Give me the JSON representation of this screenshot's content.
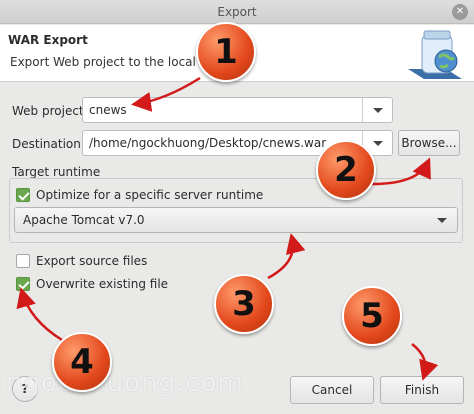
{
  "window": {
    "title": "Export",
    "close_glyph": "✕"
  },
  "header": {
    "title": "WAR Export",
    "subtitle": "Export Web project to the local file s"
  },
  "form": {
    "web_project_label": "Web project:",
    "web_project_value": "cnews",
    "destination_label": "Destination:",
    "destination_value": "/home/ngockhuong/Desktop/cnews.war",
    "browse_label": "Browse..."
  },
  "target_runtime": {
    "group_label": "Target runtime",
    "optimize_label": "Optimize for a specific server runtime",
    "optimize_checked": true,
    "runtime_value": "Apache Tomcat v7.0"
  },
  "options": {
    "export_source_label": "Export source files",
    "export_source_checked": false,
    "overwrite_label": "Overwrite existing file",
    "overwrite_checked": true
  },
  "footer": {
    "help_glyph": "?",
    "cancel_label": "Cancel",
    "finish_label": "Finish"
  },
  "markers": {
    "m1": "1",
    "m2": "2",
    "m3": "3",
    "m4": "4",
    "m5": "5"
  },
  "watermark": "ngockhuong.com",
  "colors": {
    "marker": "#e2471b",
    "check": "#6aa84f",
    "arrow": "#d21a1a"
  },
  "icons": {
    "header": "jar-globe-icon",
    "help": "help-icon",
    "dropdown": "chevron-down-icon"
  }
}
